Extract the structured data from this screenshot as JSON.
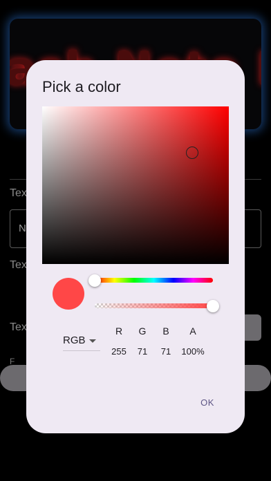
{
  "background_app": {
    "preview_text": "ash Note Bo",
    "label_1": "Tex",
    "field_text": "N",
    "label_2": "Tex",
    "label_3": "Tex",
    "label_4": "F"
  },
  "dialog": {
    "title": "Pick a color",
    "selected_color": "#ff4747",
    "hue_level": 0.0,
    "alpha_level": 1.0,
    "mode": {
      "value": "RGB"
    },
    "channels": [
      {
        "label": "R",
        "value": "255"
      },
      {
        "label": "G",
        "value": "71"
      },
      {
        "label": "B",
        "value": "71"
      },
      {
        "label": "A",
        "value": "100%"
      }
    ],
    "ok_label": "OK"
  }
}
